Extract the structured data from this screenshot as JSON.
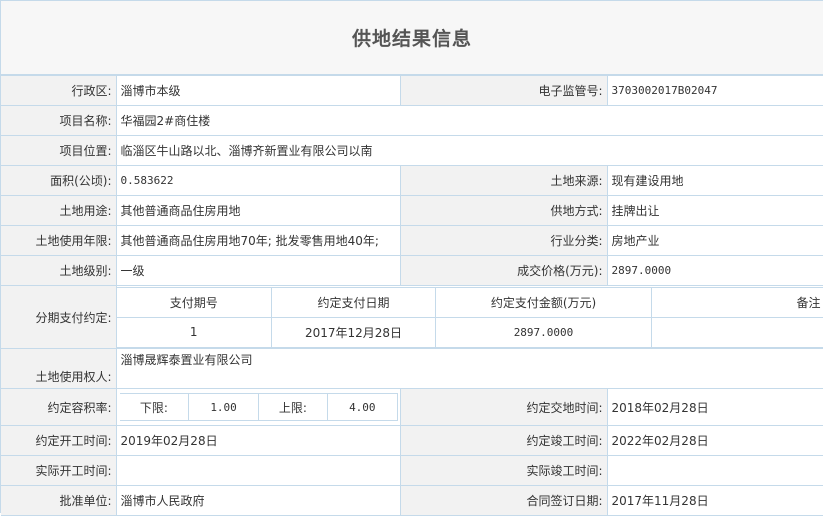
{
  "title": "供地结果信息",
  "fields": {
    "district_label": "行政区:",
    "district": "淄博市本级",
    "supervision_label": "电子监管号:",
    "supervision": "3703002017B02047",
    "project_name_label": "项目名称:",
    "project_name": "华福园2#商住楼",
    "location_label": "项目位置:",
    "location": "临淄区牛山路以北、淄博齐新置业有限公司以南",
    "area_label": "面积(公顷):",
    "area": "0.583622",
    "land_source_label": "土地来源:",
    "land_source": "现有建设用地",
    "land_use_label": "土地用途:",
    "land_use": "其他普通商品住房用地",
    "supply_method_label": "供地方式:",
    "supply_method": "挂牌出让",
    "term_label": "土地使用年限:",
    "term": "其他普通商品住房用地70年; 批发零售用地40年;",
    "industry_label": "行业分类:",
    "industry": "房地产业",
    "land_grade_label": "土地级别:",
    "land_grade": "一级",
    "price_label": "成交价格(万元):",
    "price": "2897.0000",
    "installment_label": "分期支付约定:",
    "land_user_label": "土地使用权人:",
    "land_user": "淄博晟辉泰置业有限公司",
    "far_label": "约定容积率:",
    "far_lower_label": "下限:",
    "far_lower": "1.00",
    "far_upper_label": "上限:",
    "far_upper": "4.00",
    "handover_label": "约定交地时间:",
    "handover": "2018年02月28日",
    "start_label": "约定开工时间:",
    "start": "2019年02月28日",
    "complete_label": "约定竣工时间:",
    "complete": "2022年02月28日",
    "actual_start_label": "实际开工时间:",
    "actual_start": "",
    "actual_complete_label": "实际竣工时间:",
    "actual_complete": "",
    "approver_label": "批准单位:",
    "approver": "淄博市人民政府",
    "contract_date_label": "合同签订日期:",
    "contract_date": "2017年11月28日"
  },
  "installments": {
    "headers": [
      "支付期号",
      "约定支付日期",
      "约定支付金额(万元)",
      "备注"
    ],
    "rows": [
      {
        "no": "1",
        "date": "2017年12月28日",
        "amount": "2897.0000",
        "note": ""
      }
    ]
  }
}
